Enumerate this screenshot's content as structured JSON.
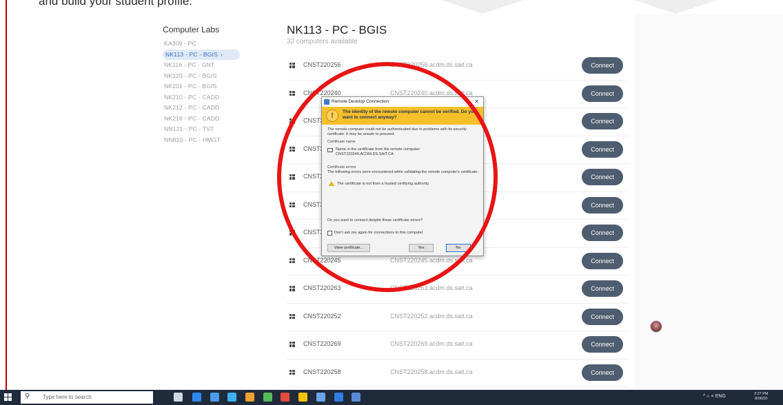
{
  "document": {
    "caption": "and build your student profile."
  },
  "sidebar": {
    "title": "Computer Labs",
    "items": [
      {
        "label": "KA309 - PC"
      },
      {
        "label": "NK113 - PC - BGIS",
        "active": true
      },
      {
        "label": "NK116 - PC - GNT"
      },
      {
        "label": "NK120 - PC - BGIS"
      },
      {
        "label": "NK201 - PC - BGIS"
      },
      {
        "label": "NK210 - PC - CADD"
      },
      {
        "label": "NK212 - PC - CADD"
      },
      {
        "label": "NK216 - PC - CADD"
      },
      {
        "label": "NN121 - PC - TVT"
      },
      {
        "label": "NN810 - PC - HMGT"
      }
    ],
    "active_chevron": "›"
  },
  "main": {
    "title": "NK113 - PC - BGIS",
    "subtitle": "32 computers available",
    "connect_label": "Connect",
    "computers": [
      {
        "name": "CNST220256",
        "host": "CNST220256.acdm.ds.sait.ca"
      },
      {
        "name": "CNST220240",
        "host": "CNST220240.acdm.ds.sait.ca"
      },
      {
        "name": "CNST220249",
        "host": ""
      },
      {
        "name": "CNST220247",
        "host": ""
      },
      {
        "name": "CNST220251",
        "host": ""
      },
      {
        "name": "CNST220254",
        "host": ""
      },
      {
        "name": "CNST220253",
        "host": ""
      },
      {
        "name": "CNST220245",
        "host": "CNST220245.acdm.ds.sait.ca"
      },
      {
        "name": "CNST220263",
        "host": "CNST220263.acdm.ds.sait.ca"
      },
      {
        "name": "CNST220252",
        "host": "CNST220252.acdm.ds.sait.ca"
      },
      {
        "name": "CNST220269",
        "host": "CNST220269.acdm.ds.sait.ca"
      },
      {
        "name": "CNST220258",
        "host": "CNST220258.acdm.ds.sait.ca"
      }
    ]
  },
  "dialog": {
    "title": "Remote Desktop Connection",
    "close_glyph": "✕",
    "banner": "The identity of the remote computer cannot be verified. Do you want to connect anyway?",
    "warn_glyph": "!",
    "intro": "The remote computer could not be authenticated due to problems with its security certificate. It may be unsafe to proceed.",
    "cert_name_heading": "Certificate name",
    "cert_name_label": "Name in the certificate from the remote computer:",
    "cert_name_value": "CNST220249.ACDM.DS.SAIT.CA",
    "cert_errors_heading": "Certificate errors",
    "cert_errors_text": "The following errors were encountered while validating the remote computer's certificate:",
    "cert_error_item": "The certificate is not from a trusted certifying authority.",
    "question": "Do you want to connect despite these certificate errors?",
    "checkbox_label": "Don't ask me again for connections to this computer",
    "view_label": "View certificate...",
    "yes_label": "Yes",
    "no_label": "No"
  },
  "taskbar": {
    "search_placeholder": "Type here to search",
    "search_glyph": "⚲",
    "tray_text": "^  ⌂  ⋄  ENG",
    "time": "3:27 PM",
    "date": "8/06/20",
    "app_icon_colors": [
      "#cfd8e3",
      "#2d89ef",
      "#4a9be8",
      "#3cb0f0",
      "#f0a030",
      "#57b85a",
      "#e24b3d",
      "#f2c500",
      "#6aa6e8",
      "#2f7de1",
      "#5b8bd6"
    ]
  },
  "colors": {
    "accent": "#3a6fbd",
    "button": "#4e5e70",
    "highlight_ring": "#e81414",
    "banner": "#f5c02a"
  }
}
